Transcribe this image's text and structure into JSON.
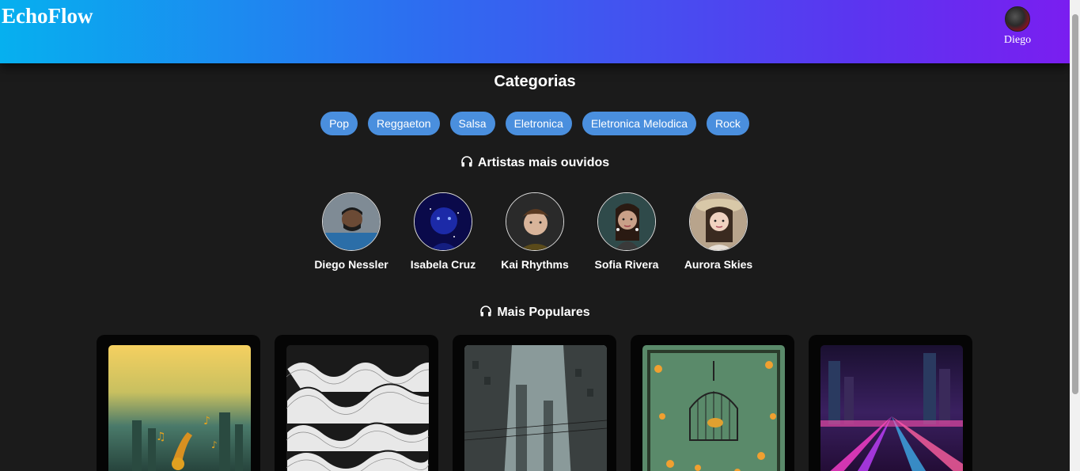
{
  "app": {
    "logo": "EchoFlow"
  },
  "user": {
    "name": "Diego",
    "avatar_icon": "user-avatar"
  },
  "categories": {
    "title": "Categorias",
    "items": [
      "Pop",
      "Reggaeton",
      "Salsa",
      "Eletronica",
      "Eletronica Melodica",
      "Rock"
    ]
  },
  "artists": {
    "title": "Artistas mais ouvidos",
    "icon": "headphones-icon",
    "items": [
      {
        "name": "Diego Nessler"
      },
      {
        "name": "Isabela Cruz"
      },
      {
        "name": "Kai Rhythms"
      },
      {
        "name": "Sofia Rivera"
      },
      {
        "name": "Aurora Skies"
      }
    ]
  },
  "popular": {
    "title": "Mais Populares",
    "icon": "headphones-icon",
    "items": [
      "city-sunset-music-art",
      "wave-lines-art",
      "city-street-art",
      "bird-cage-flowers-art",
      "neon-city-road-art"
    ]
  },
  "colors": {
    "accent": "#4a8fde",
    "header_start": "#06b0ef",
    "header_end": "#7a1ef0",
    "background": "#1b1b1b"
  }
}
